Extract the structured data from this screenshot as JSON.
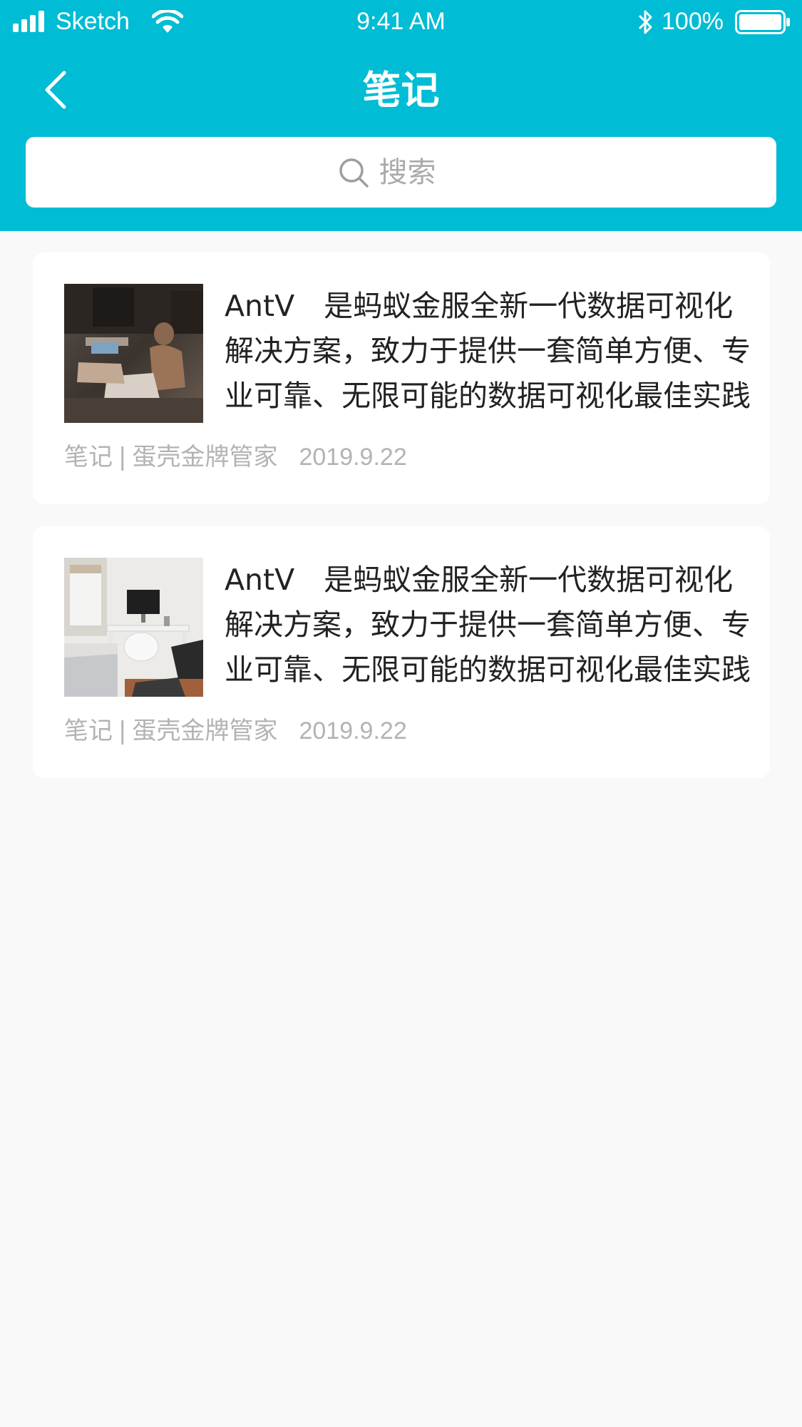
{
  "status_bar": {
    "carrier": "Sketch",
    "time": "9:41 AM",
    "battery": "100%"
  },
  "nav": {
    "title": "笔记"
  },
  "search": {
    "placeholder": "搜索"
  },
  "notes": [
    {
      "text": "AntV　是蚂蚁金服全新一代数据可视化解决方案，致力于提供一套简单方便、专业可靠、无限可能的数据可视化最佳实践",
      "category": "笔记",
      "separator": "|",
      "author": "蛋壳金牌管家",
      "date": "2019.9.22"
    },
    {
      "text": "AntV　是蚂蚁金服全新一代数据可视化解决方案，致力于提供一套简单方便、专业可靠、无限可能的数据可视化最佳实践",
      "category": "笔记",
      "separator": "|",
      "author": "蛋壳金牌管家",
      "date": "2019.9.22"
    }
  ],
  "colors": {
    "header": "#00bcd4",
    "background": "#f9f9f9",
    "meta_text": "#b3b3b3"
  }
}
